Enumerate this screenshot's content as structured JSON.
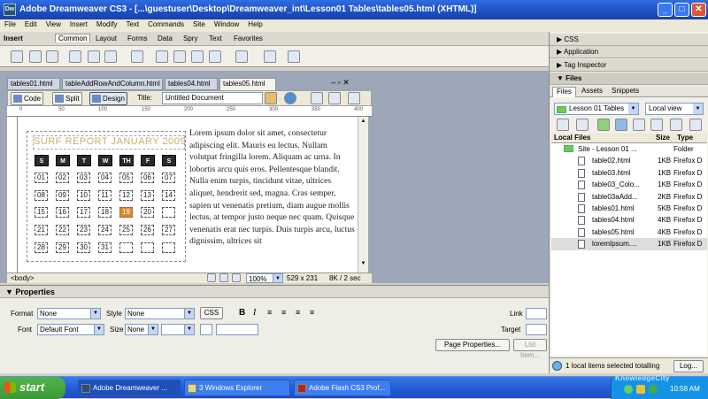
{
  "window": {
    "title": "Adobe Dreamweaver CS3 - [...\\guestuser\\Desktop\\Dreamweaver_int\\Lesson01 Tables\\tables05.html (XHTML)]",
    "app_icon": "Dw"
  },
  "menu": [
    "File",
    "Edit",
    "View",
    "Insert",
    "Modify",
    "Text",
    "Commands",
    "Site",
    "Window",
    "Help"
  ],
  "insert_bar": {
    "label": "Insert",
    "tabs": [
      "Common",
      "Layout",
      "Forms",
      "Data",
      "Spry",
      "Text",
      "Favorites"
    ],
    "active": "Common"
  },
  "doc_tabs": [
    "tables01.html",
    "tableAddRowAndColumn.html",
    "tables04.html",
    "tables05.html"
  ],
  "doc_toolbar": {
    "code": "Code",
    "split": "Split",
    "design": "Design",
    "title_label": "Title:",
    "title_value": "Untitled Document"
  },
  "ruler": [
    "0",
    "50",
    "100",
    "150",
    "200",
    "250",
    "300",
    "350",
    "400"
  ],
  "calendar": {
    "title": "SURF REPORT JANUARY 2009",
    "headers": [
      "S",
      "M",
      "T",
      "W",
      "TH",
      "F",
      "S"
    ],
    "rows": [
      [
        "01",
        "02",
        "03",
        "04",
        "05",
        "06",
        "07"
      ],
      [
        "08",
        "09",
        "10",
        "11",
        "12",
        "13",
        "14"
      ],
      [
        "15",
        "16",
        "17",
        "18",
        "19",
        "20"
      ],
      [
        "21",
        "22",
        "23",
        "24",
        "25",
        "26",
        "27"
      ],
      [
        "28",
        "29",
        "30",
        "31",
        "",
        "",
        ""
      ]
    ],
    "highlight": "19"
  },
  "lorem": "Lorem ipsum dolor sit amet, consectetur adipiscing elit. Mauris eu lectus. Nullam volutpat fringilla lorem. Aliquam ac urna. In lobortis arcu quis eros. Pellentesque blandit. Nulla enim turpis, tincidunt vitae, ultrices aliquet, hendrerit sed, magna. Cras semper, sapien ut venenatis pretium, diam augue mollis lectus, at tempor justo neque nec quam. Quisque venenatis erat nec turpis. Duis turpis arcu, luctus dignissim, ultrices sit",
  "status": {
    "tag": "<body>",
    "zoom": "100%",
    "size": "529 x 231",
    "weight": "8K / 2 sec"
  },
  "properties": {
    "title": "Properties",
    "format_label": "Format",
    "format_value": "None",
    "style_label": "Style",
    "style_value": "None",
    "css_btn": "CSS",
    "bold": "B",
    "italic": "I",
    "link_label": "Link",
    "font_label": "Font",
    "font_value": "Default Font",
    "size_label": "Size",
    "size_value": "None",
    "target_label": "Target",
    "page_props": "Page Properties...",
    "list_item": "List Item..."
  },
  "right_panel": {
    "css": "CSS",
    "application": "Application",
    "tag_inspector": "Tag Inspector",
    "files": "Files",
    "tabs": [
      "Files",
      "Assets",
      "Snippets"
    ],
    "site_select": "Lesson 01 Tables",
    "view_select": "Local view",
    "col_headers": [
      "Local Files",
      "Size",
      "Type"
    ],
    "rows": [
      {
        "name": "Site - Lesson 01 ...",
        "size": "",
        "type": "Folder",
        "folder": true
      },
      {
        "name": "table02.html",
        "size": "1KB",
        "type": "Firefox D"
      },
      {
        "name": "table03.html",
        "size": "1KB",
        "type": "Firefox D"
      },
      {
        "name": "table03_Colo...",
        "size": "1KB",
        "type": "Firefox D"
      },
      {
        "name": "table03aAdd...",
        "size": "2KB",
        "type": "Firefox D"
      },
      {
        "name": "tables01.html",
        "size": "5KB",
        "type": "Firefox D"
      },
      {
        "name": "tables04.html",
        "size": "4KB",
        "type": "Firefox D"
      },
      {
        "name": "tables05.html",
        "size": "4KB",
        "type": "Firefox D"
      },
      {
        "name": "loremIpsum....",
        "size": "1KB",
        "type": "Firefox D"
      }
    ],
    "status": "1 local items selected totalling",
    "log": "Log..."
  },
  "taskbar": {
    "start": "start",
    "tasks": [
      "Adobe Dreamweaver ...",
      "3 Windows Explorer",
      "Adobe Flash CS3 Prof..."
    ],
    "clock": "10:58 AM",
    "watermark": "KnowledgeCity"
  }
}
